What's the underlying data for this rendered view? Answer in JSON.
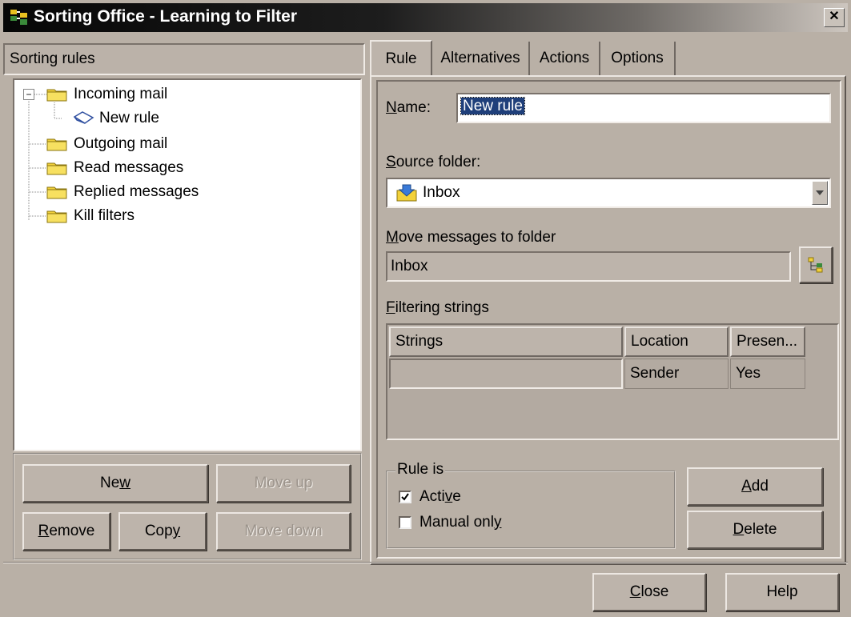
{
  "window": {
    "title": "Sorting Office - Learning to Filter",
    "close_glyph": "✕"
  },
  "left": {
    "header": "Sorting rules",
    "tree": [
      {
        "label": "Incoming mail",
        "expander": "−"
      },
      {
        "label": "New rule"
      },
      {
        "label": "Outgoing mail"
      },
      {
        "label": "Read messages"
      },
      {
        "label": "Replied messages"
      },
      {
        "label": "Kill filters"
      }
    ],
    "buttons": {
      "new_pre": "Ne",
      "new_key": "w",
      "new_post": "",
      "move_up": "Move up",
      "remove_pre": "",
      "remove_key": "R",
      "remove_post": "emove",
      "copy_pre": "Cop",
      "copy_key": "y",
      "copy_post": "",
      "move_down": "Move down"
    }
  },
  "tabs": [
    "Rule",
    "Alternatives",
    "Actions",
    "Options"
  ],
  "rule": {
    "name_label_key": "N",
    "name_label_rest": "ame:",
    "name_value": "New rule",
    "source_label_key": "S",
    "source_label_rest": "ource folder:",
    "source_value": "Inbox",
    "move_label_key": "M",
    "move_label_rest": "ove messages to folder",
    "move_value": "Inbox",
    "filter_label_key": "F",
    "filter_label_rest": "iltering strings",
    "columns": [
      "Strings",
      "Location",
      "Presen..."
    ],
    "rows": [
      {
        "strings": "",
        "location": "Sender",
        "presence": "Yes"
      }
    ],
    "rule_is_label": "Rule is",
    "active_pre": "Acti",
    "active_key": "v",
    "active_post": "e",
    "active_checked": true,
    "manual_pre": "Manual onl",
    "manual_key": "y",
    "manual_post": "",
    "manual_checked": false,
    "add_key": "A",
    "add_rest": "dd",
    "delete_key": "D",
    "delete_rest": "elete"
  },
  "footer": {
    "close_key": "C",
    "close_rest": "lose",
    "help": "Help"
  }
}
